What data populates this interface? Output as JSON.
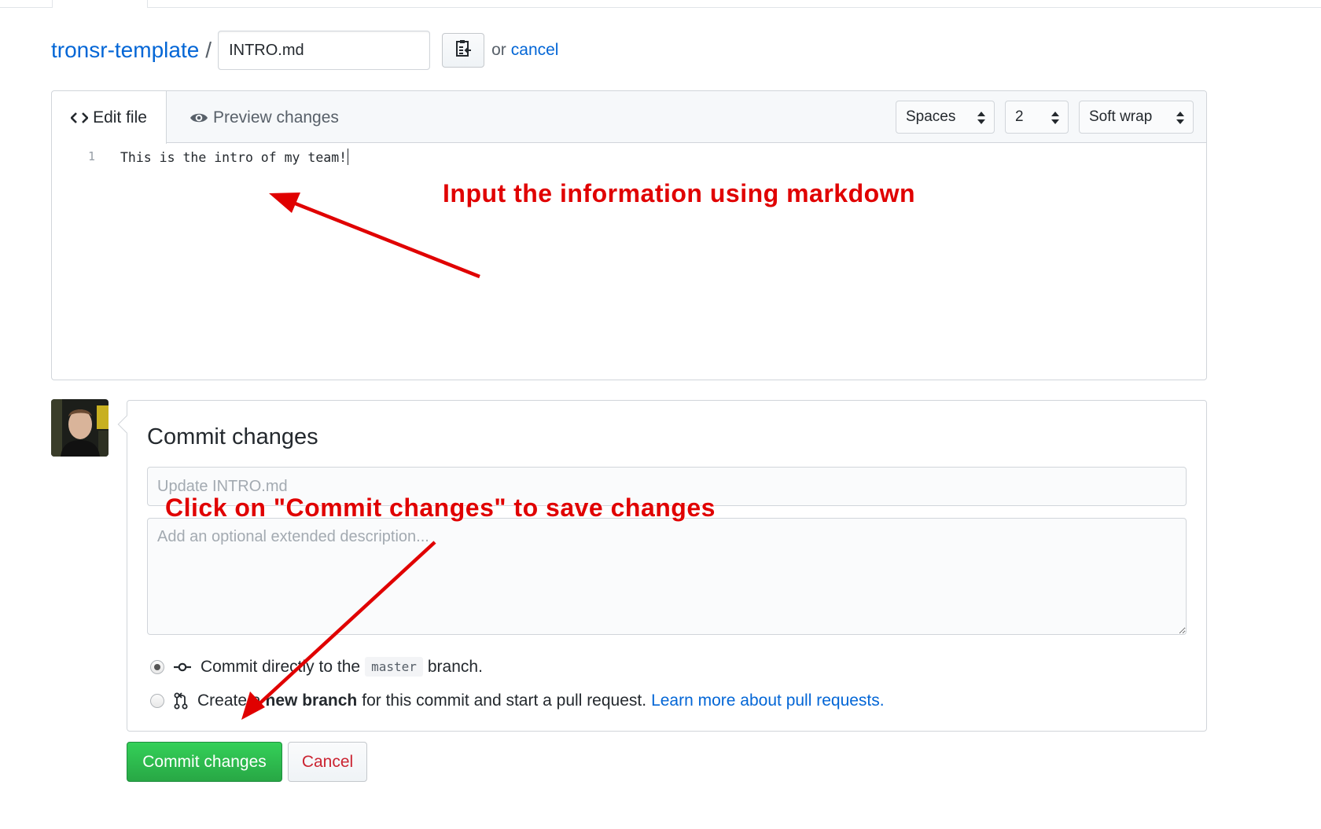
{
  "breadcrumb": {
    "repo": "tronsr-template",
    "separator": "/",
    "filename": "INTRO.md",
    "or_text": "or",
    "cancel_link": "cancel"
  },
  "editor": {
    "tabs": [
      {
        "label": "Edit file",
        "icon": "code-icon",
        "active": true
      },
      {
        "label": "Preview changes",
        "icon": "eye-icon",
        "active": false
      }
    ],
    "indent_mode": "Spaces",
    "indent_size": "2",
    "wrap_mode": "Soft wrap",
    "lines": [
      {
        "number": "1",
        "text": "This is the intro of my team!"
      }
    ]
  },
  "commit": {
    "title": "Commit changes",
    "summary_placeholder": "Update INTRO.md",
    "description_placeholder": "Add an optional extended description...",
    "option_direct": {
      "prefix": "Commit directly to the",
      "branch": "master",
      "suffix": "branch.",
      "selected": true,
      "icon": "git-commit-icon"
    },
    "option_new_branch": {
      "prefix": "Create a",
      "bold": "new branch",
      "suffix": "for this commit and start a pull request.",
      "link": "Learn more about pull requests.",
      "selected": false,
      "icon": "git-pull-request-icon"
    },
    "submit_label": "Commit changes",
    "cancel_label": "Cancel"
  },
  "annotations": {
    "editor_hint": "Input the information using markdown",
    "commit_hint": "Click on \"Commit changes\" to save changes"
  },
  "colors": {
    "link": "#0366d6",
    "commit_green": "#28a745",
    "cancel_red": "#cb2431",
    "annotation_red": "#e00000"
  }
}
